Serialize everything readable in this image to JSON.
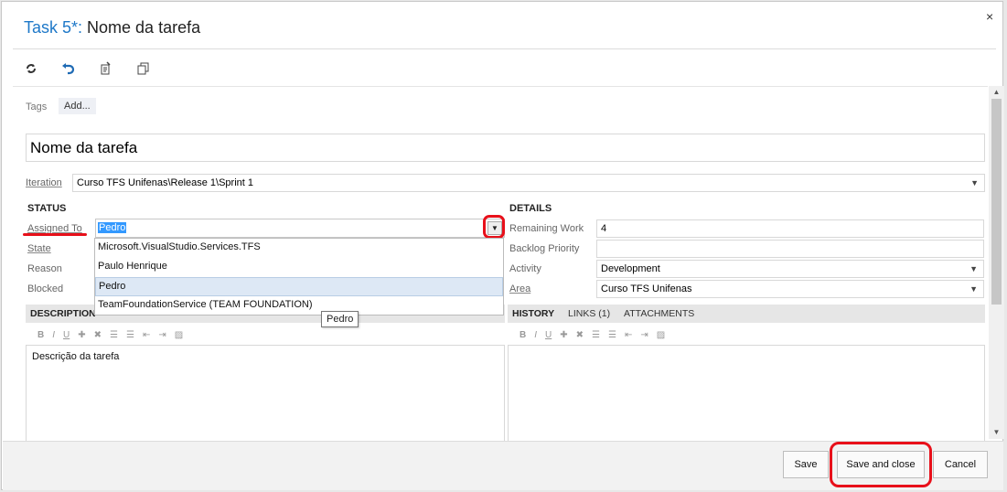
{
  "dialog": {
    "title_type": "Task 5*:",
    "title_name": " Nome da tarefa",
    "close_glyph": "×"
  },
  "toolbar": [
    "refresh-icon",
    "undo-icon",
    "link-icon",
    "copy-icon"
  ],
  "tags": {
    "label": "Tags",
    "add": "Add..."
  },
  "work_item_title": "Nome da tarefa",
  "iteration": {
    "label": "Iteration",
    "value": "Curso TFS Unifenas\\Release 1\\Sprint 1"
  },
  "status": {
    "header": "STATUS",
    "assigned_label": "Assigned To",
    "assigned_value": "Pedro",
    "state_label": "State",
    "reason_label": "Reason",
    "blocked_label": "Blocked"
  },
  "dropdown": {
    "options": [
      "Microsoft.VisualStudio.Services.TFS",
      "Paulo Henrique",
      "Pedro",
      "TeamFoundationService (TEAM FOUNDATION)"
    ],
    "selected": "Pedro",
    "tooltip": "Pedro"
  },
  "details": {
    "header": "DETAILS",
    "remaining_label": "Remaining Work",
    "remaining_value": "4",
    "backlog_label": "Backlog Priority",
    "backlog_value": "",
    "activity_label": "Activity",
    "activity_value": "Development",
    "area_label": "Area",
    "area_value": "Curso TFS Unifenas"
  },
  "description": {
    "header": "DESCRIPTION",
    "text": "Descrição da tarefa"
  },
  "history": {
    "tab_history": "HISTORY",
    "tab_links": "LINKS (1)",
    "tab_attachments": "ATTACHMENTS"
  },
  "rte_glyphs": [
    "B",
    "I",
    "U"
  ],
  "footer": {
    "save": "Save",
    "save_close": "Save and close",
    "cancel": "Cancel"
  },
  "colors": {
    "accent": "#1e78c8",
    "annotation": "#e8101a",
    "selection": "#3399ff"
  }
}
